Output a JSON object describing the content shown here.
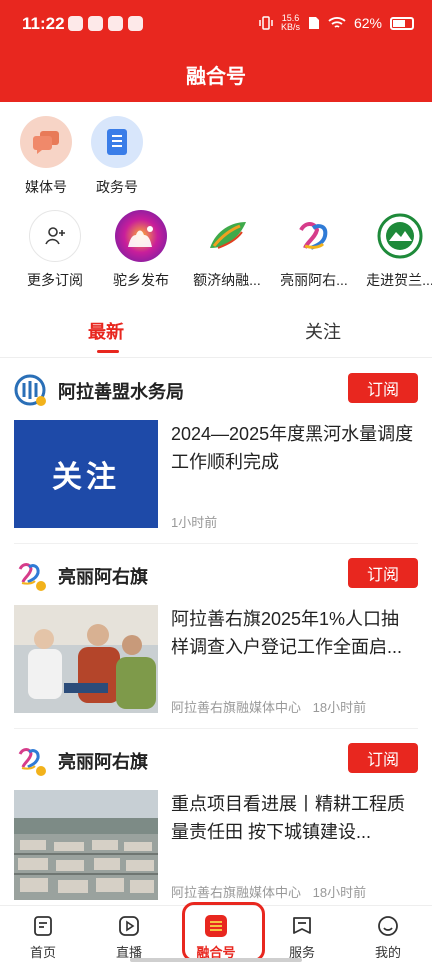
{
  "status_bar": {
    "time": "11:22",
    "net_speed": "15.6",
    "net_unit": "KB/s",
    "battery": "62%"
  },
  "header": {
    "title": "融合号"
  },
  "categories": [
    {
      "label": "媒体号",
      "icon": "chat-bubbles-icon",
      "color": "#f0896a"
    },
    {
      "label": "政务号",
      "icon": "document-icon",
      "color": "#3a7de8"
    }
  ],
  "subscriptions": [
    {
      "label": "更多订阅",
      "icon": "add-user-icon"
    },
    {
      "label": "驼乡发布",
      "icon": "camel-logo"
    },
    {
      "label": "额济纳融...",
      "icon": "leaf-logo"
    },
    {
      "label": "亮丽阿右...",
      "icon": "ayq-logo"
    },
    {
      "label": "走进贺兰...",
      "icon": "helan-logo"
    }
  ],
  "tabs": [
    {
      "label": "最新",
      "active": true
    },
    {
      "label": "关注",
      "active": false
    }
  ],
  "feed": [
    {
      "source": "阿拉善盟水务局",
      "subscribe_label": "订阅",
      "thumb_text": "关注",
      "title": "2024—2025年度黑河水量调度工作顺利完成",
      "meta_source": "",
      "time": "1小时前"
    },
    {
      "source": "亮丽阿右旗",
      "subscribe_label": "订阅",
      "thumb_text": "",
      "title": "阿拉善右旗2025年1%人口抽样调查入户登记工作全面启...",
      "meta_source": "阿拉善右旗融媒体中心",
      "time": "18小时前"
    },
    {
      "source": "亮丽阿右旗",
      "subscribe_label": "订阅",
      "thumb_text": "",
      "title": "重点项目看进展丨精耕工程质量责任田 按下城镇建设...",
      "meta_source": "阿拉善右旗融媒体中心",
      "time": "18小时前"
    }
  ],
  "bottom_nav": [
    {
      "label": "首页",
      "icon": "home-icon"
    },
    {
      "label": "直播",
      "icon": "live-icon"
    },
    {
      "label": "融合号",
      "icon": "rongheh-icon",
      "active": true
    },
    {
      "label": "服务",
      "icon": "service-icon"
    },
    {
      "label": "我的",
      "icon": "smile-icon"
    }
  ],
  "colors": {
    "accent": "#e8271f"
  }
}
